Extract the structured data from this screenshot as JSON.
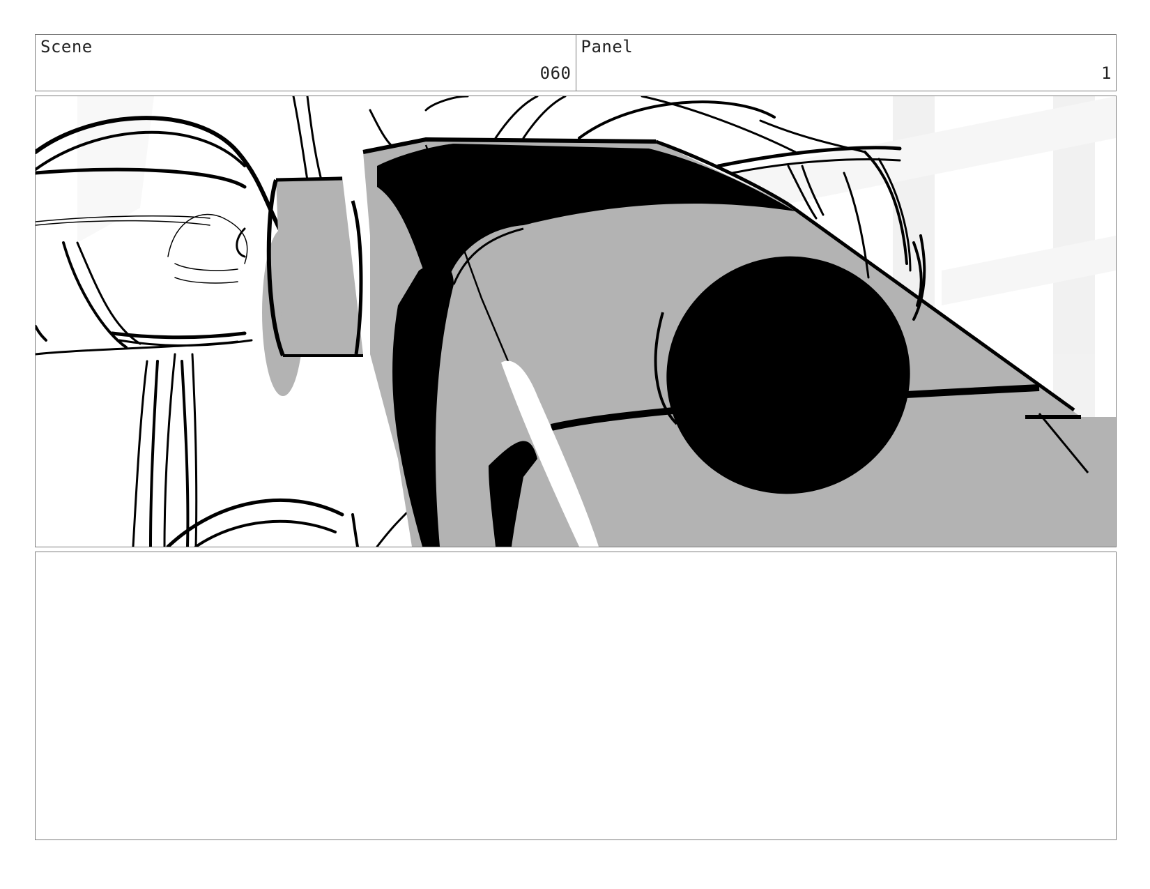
{
  "header": {
    "scene_label": "Scene",
    "scene_value": "060",
    "panel_label": "Panel",
    "panel_value": "1"
  },
  "frame": {
    "shade_color": "#b3b3b3",
    "ink_color": "#000000"
  },
  "notes": {
    "text": ""
  }
}
